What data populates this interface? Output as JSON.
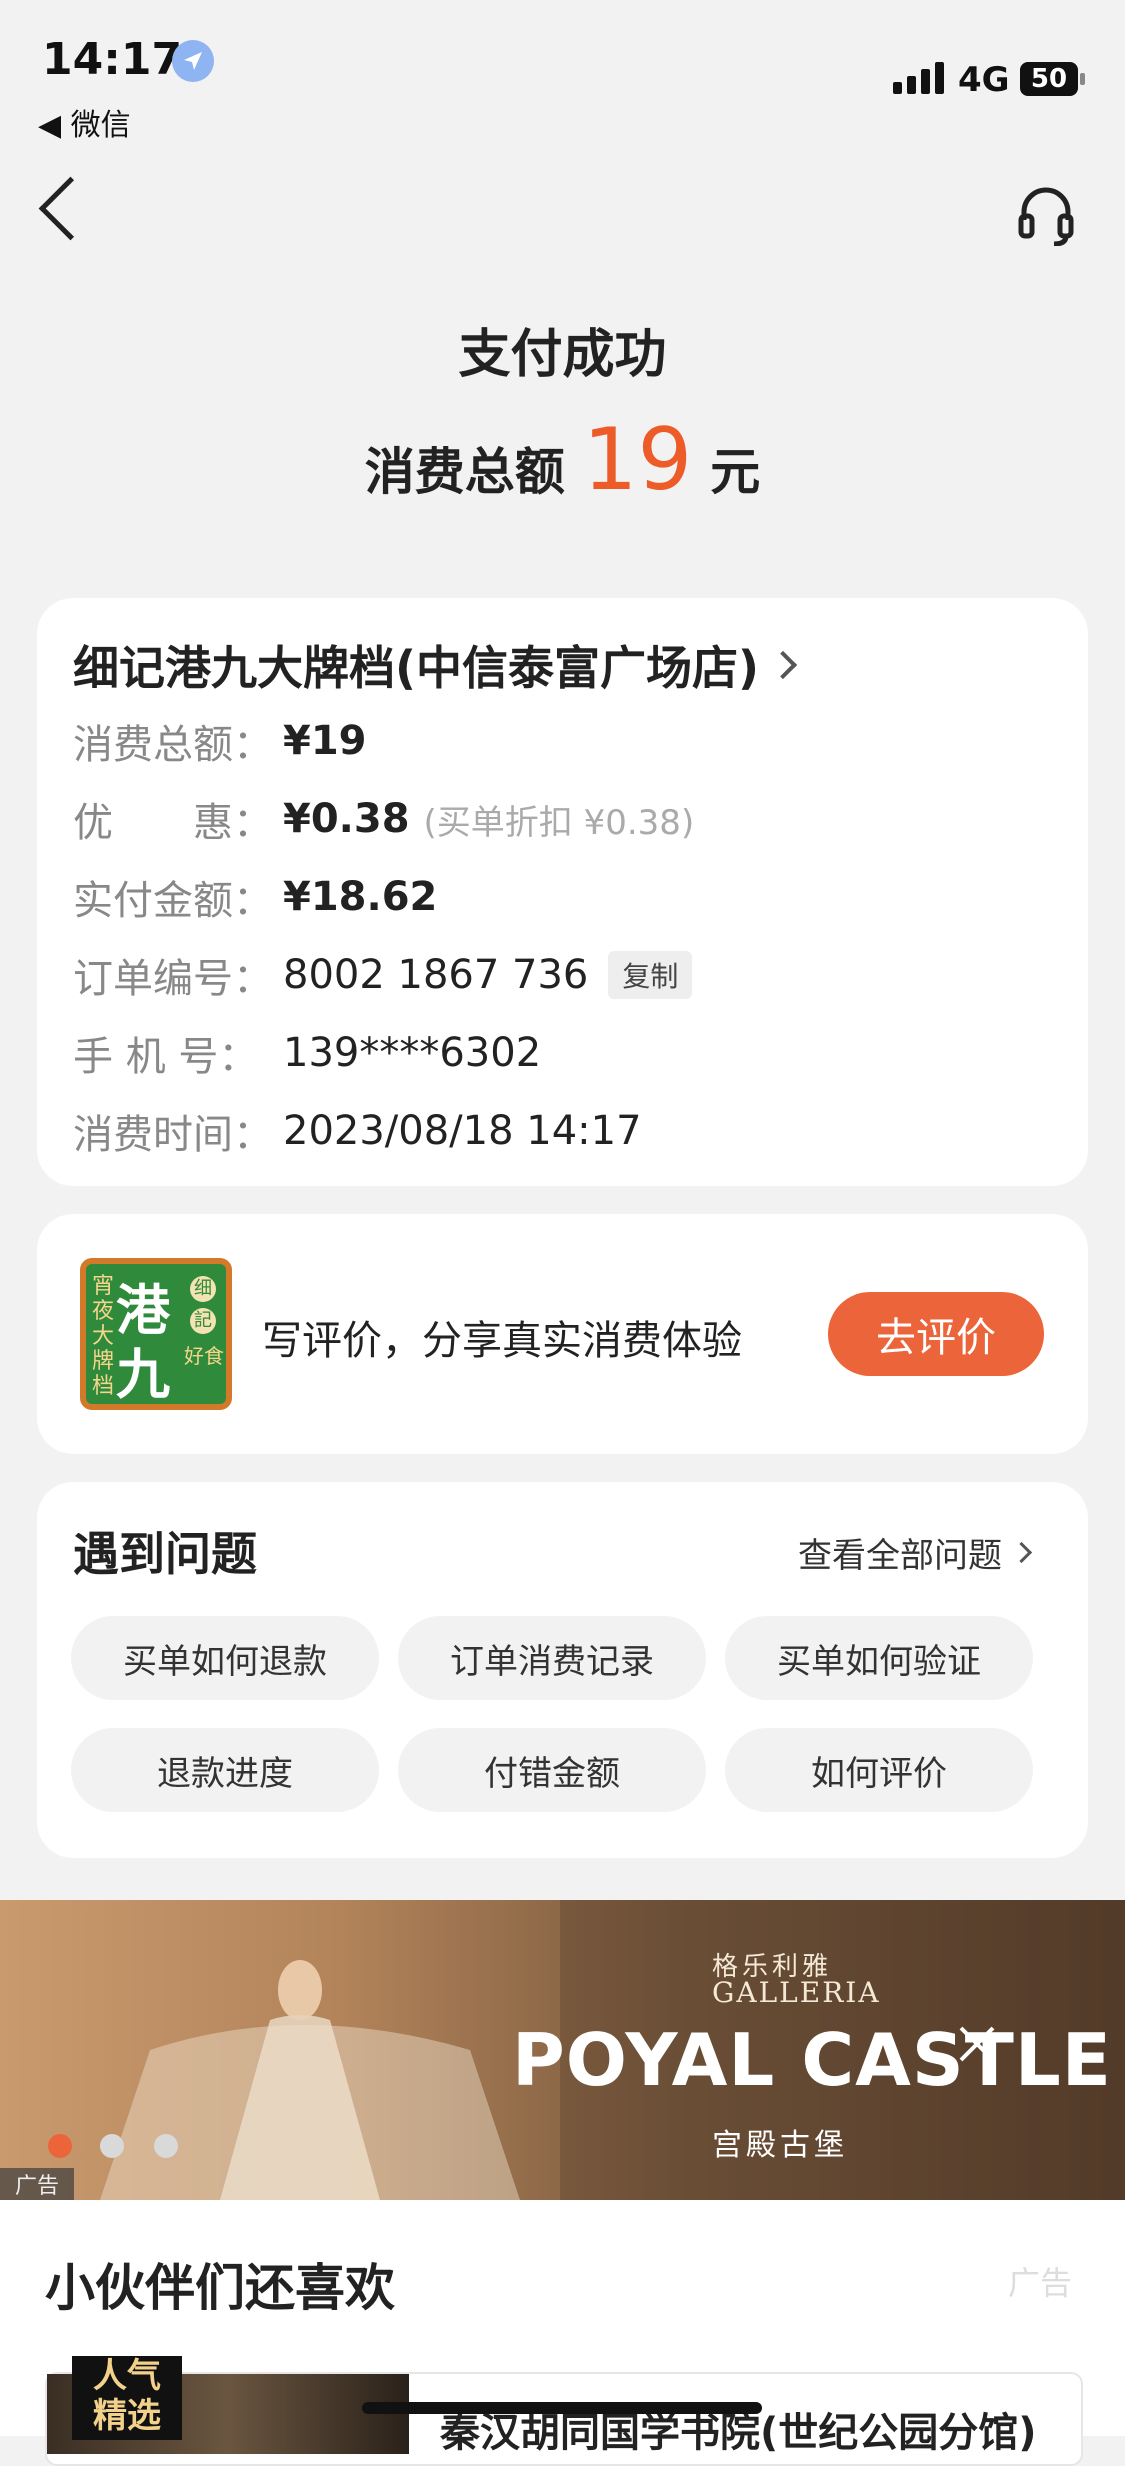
{
  "status_bar": {
    "time": "14:17",
    "back_app": "◀ 微信",
    "network": "4G",
    "battery": "50"
  },
  "header": {
    "title": "支付成功",
    "amount_prefix": "消费总额",
    "amount_value": "19",
    "amount_unit": "元"
  },
  "order": {
    "store_name": "细记港九大牌档(中信泰富广场店)",
    "rows": [
      {
        "label": "消费总额：",
        "value": "¥19"
      },
      {
        "label": "优　　惠：",
        "value": "¥0.38",
        "note": "(买单折扣 ¥0.38)"
      },
      {
        "label": "实付金额：",
        "value": "¥18.62"
      },
      {
        "label": "订单编号：",
        "value": "8002 1867 736",
        "action": "复制"
      },
      {
        "label": "手  机  号：",
        "value": "139****6302"
      },
      {
        "label": "消费时间：",
        "value": "2023/08/18 14:17"
      }
    ]
  },
  "review": {
    "logo_text": {
      "big1": "港",
      "big2": "九",
      "side_left": "宵夜大牌档",
      "side_right1": "细",
      "side_right2": "記",
      "side_right3": "好食"
    },
    "prompt": "写评价，分享真实消费体验",
    "button": "去评价"
  },
  "faq": {
    "title": "遇到问题",
    "view_all": "查看全部问题",
    "chips": [
      "买单如何退款",
      "订单消费记录",
      "买单如何验证",
      "退款进度",
      "付错金额",
      "如何评价"
    ]
  },
  "banner": {
    "brand_cn": "格乐利雅",
    "brand_en": "GALLERIA",
    "headline": "POYAL CASTLE",
    "sub": "宫殿古堡",
    "ad_label": "广告",
    "active_dot": 0,
    "dot_colors": [
      "#ec643a",
      "#d9d9d9",
      "#d9d9d9"
    ]
  },
  "recommend": {
    "title": "小伙伴们还喜欢",
    "ad_label": "广告",
    "badge": [
      "人气",
      "精选"
    ],
    "first_item": "秦汉胡同国学书院(世纪公园分馆)"
  },
  "colors": {
    "accent": "#ec5b28",
    "button": "#ec643a"
  }
}
